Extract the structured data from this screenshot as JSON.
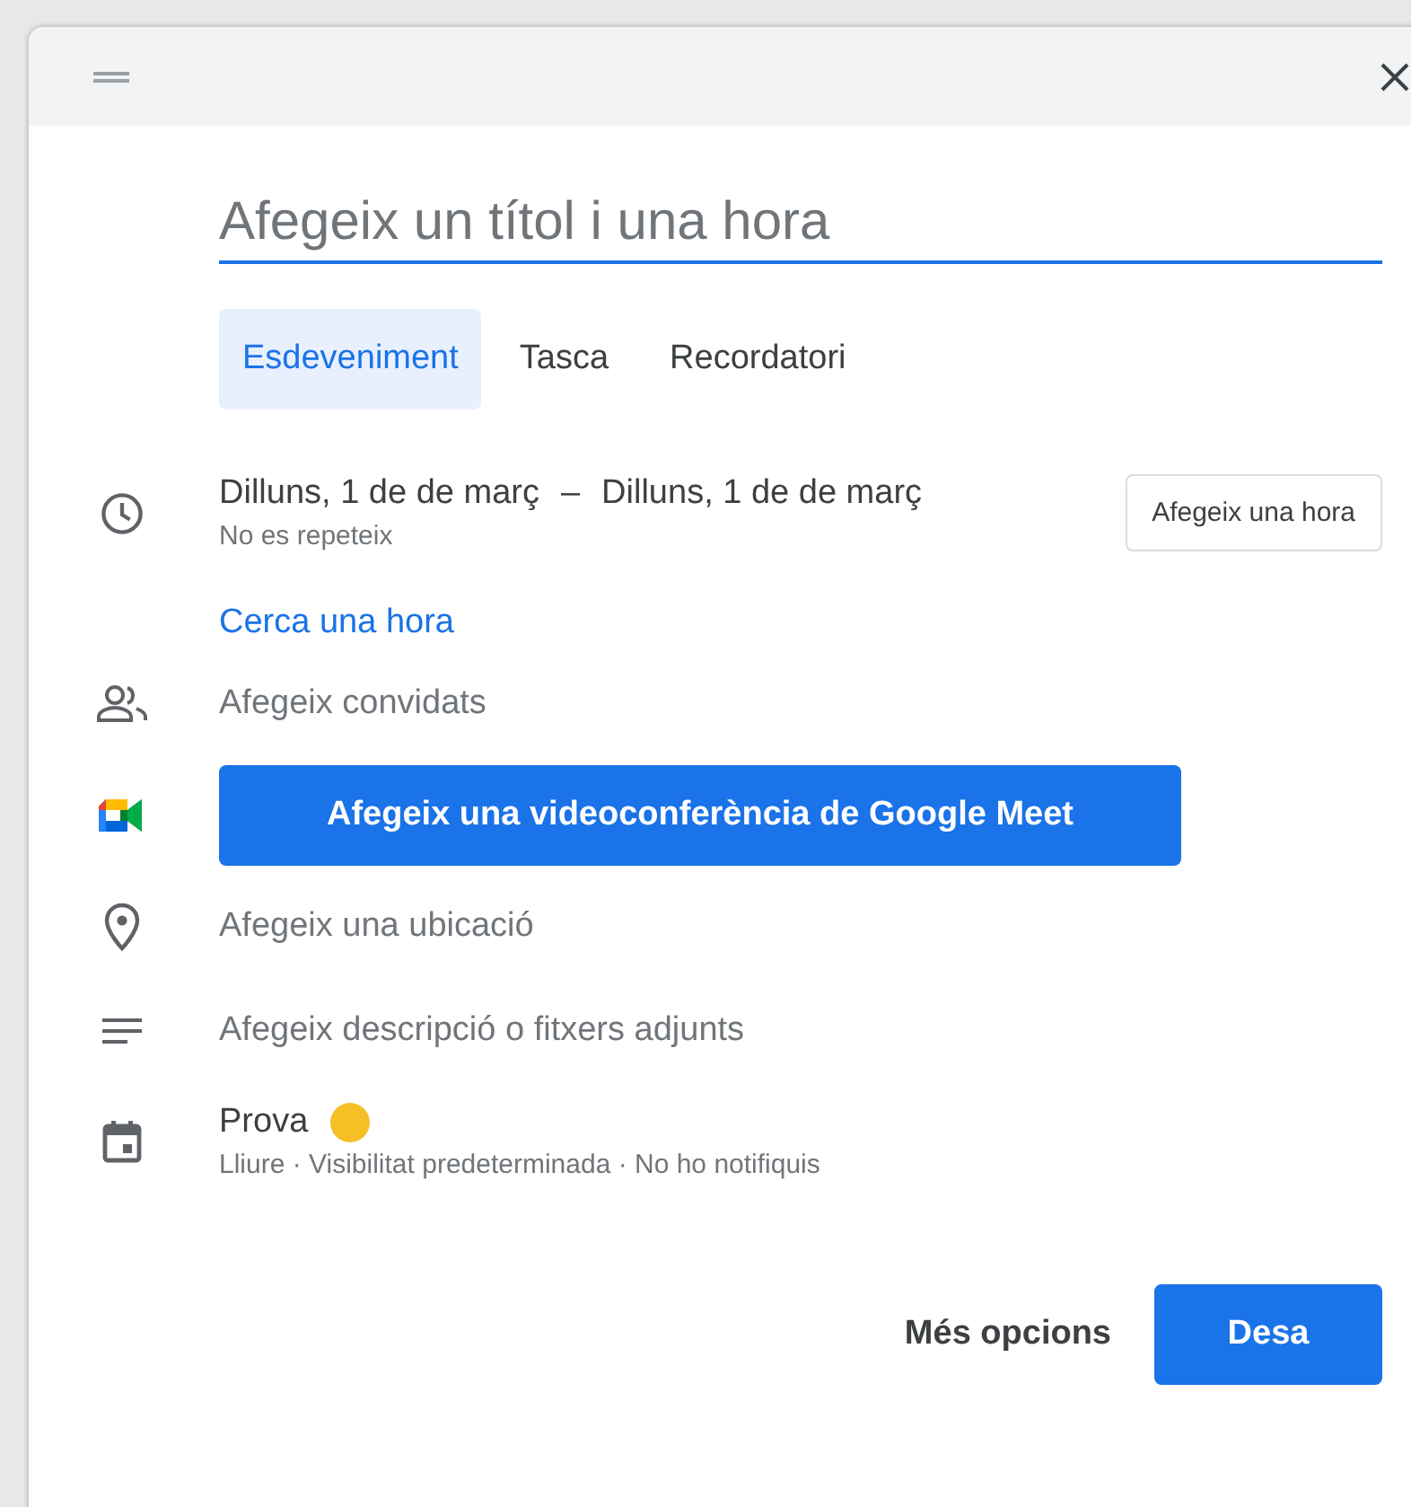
{
  "title_field": {
    "placeholder": "Afegeix un títol i una hora"
  },
  "tabs": [
    {
      "label": "Esdeveniment",
      "selected": true
    },
    {
      "label": "Tasca",
      "selected": false
    },
    {
      "label": "Recordatori",
      "selected": false
    }
  ],
  "date": {
    "start": "Dilluns, 1 de de març",
    "separator": "–",
    "end": "Dilluns, 1 de de març",
    "repeat": "No es repeteix",
    "add_time_button": "Afegeix una hora"
  },
  "find_time_link": "Cerca una hora",
  "guests": {
    "placeholder": "Afegeix convidats"
  },
  "meet_button": "Afegeix una videoconferència de Google Meet",
  "location": {
    "placeholder": "Afegeix una ubicació"
  },
  "description": {
    "placeholder": "Afegeix descripció o fitxers adjunts"
  },
  "calendar": {
    "name": "Prova",
    "color": "#f6bf26",
    "details": "Lliure · Visibilitat predeterminada · No ho notifiquis"
  },
  "buttons": {
    "more_options": "Més opcions",
    "save": "Desa"
  }
}
